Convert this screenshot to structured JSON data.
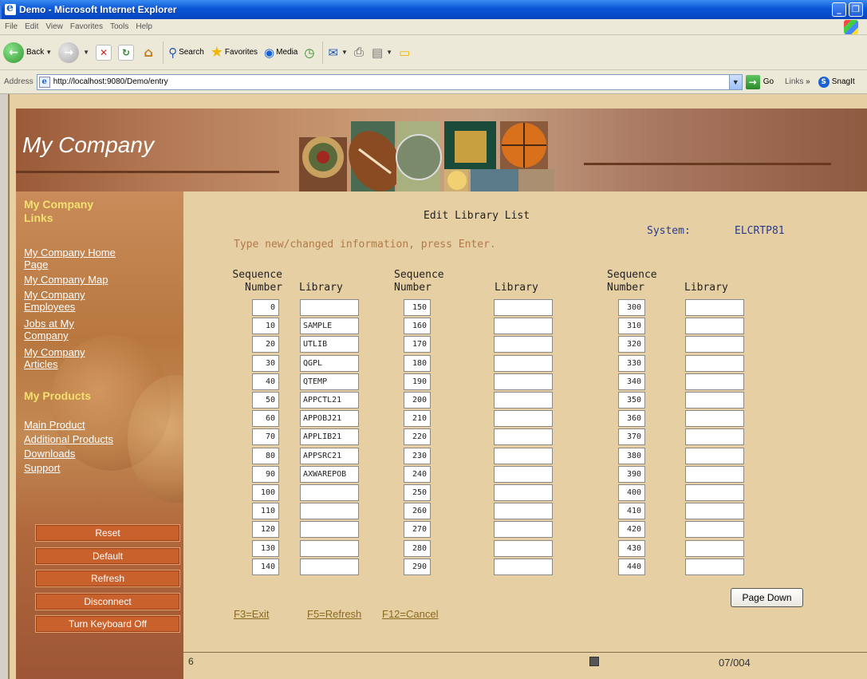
{
  "window": {
    "title": "Demo - Microsoft Internet Explorer",
    "minimize_glyph": "_",
    "maximize_glyph": "❐"
  },
  "menu": [
    "File",
    "Edit",
    "View",
    "Favorites",
    "Tools",
    "Help"
  ],
  "toolbar": {
    "back_label": "Back",
    "search_label": "Search",
    "favorites_label": "Favorites",
    "media_label": "Media"
  },
  "address": {
    "label": "Address",
    "url": "http://localhost:9080/Demo/entry",
    "go_label": "Go",
    "links_label": "Links",
    "chevron": "»",
    "snagit_label": "SnagIt"
  },
  "banner": {
    "brand": "My Company"
  },
  "sidebar": {
    "heading_links": [
      "My Company",
      "Links"
    ],
    "links": [
      [
        "My Company Home",
        "Page"
      ],
      [
        "My Company Map"
      ],
      [
        "My Company",
        "Employees"
      ],
      [
        "Jobs at My",
        "Company"
      ],
      [
        "My Company",
        "Articles"
      ]
    ],
    "heading_products": "My Products",
    "product_links": [
      "Main Product",
      "Additional Products",
      "Downloads",
      "Support"
    ],
    "buttons": [
      "Reset",
      "Default",
      "Refresh",
      "Disconnect",
      "Turn Keyboard Off"
    ]
  },
  "screen": {
    "title": "Edit Library List",
    "system_label": "System:",
    "system_value": "ELCRTP81",
    "instruction": "Type new/changed information, press Enter.",
    "seq_header_1": "Sequence",
    "seq_header_2": "Number",
    "lib_header": "Library"
  },
  "columns": [
    {
      "seq": [
        "0",
        "10",
        "20",
        "30",
        "40",
        "50",
        "60",
        "70",
        "80",
        "90",
        "100",
        "110",
        "120",
        "130",
        "140"
      ],
      "lib": [
        "",
        "SAMPLE",
        "UTLIB",
        "QGPL",
        "QTEMP",
        "APPCTL21",
        "APPOBJ21",
        "APPLIB21",
        "APPSRC21",
        "AXWAREPOB",
        "",
        "",
        "",
        "",
        ""
      ]
    },
    {
      "seq": [
        "150",
        "160",
        "170",
        "180",
        "190",
        "200",
        "210",
        "220",
        "230",
        "240",
        "250",
        "260",
        "270",
        "280",
        "290"
      ],
      "lib": [
        "",
        "",
        "",
        "",
        "",
        "",
        "",
        "",
        "",
        "",
        "",
        "",
        "",
        "",
        ""
      ]
    },
    {
      "seq": [
        "300",
        "310",
        "320",
        "330",
        "340",
        "350",
        "360",
        "370",
        "380",
        "390",
        "400",
        "410",
        "420",
        "430",
        "440"
      ],
      "lib": [
        "",
        "",
        "",
        "",
        "",
        "",
        "",
        "",
        "",
        "",
        "",
        "",
        "",
        "",
        ""
      ]
    }
  ],
  "function_keys": [
    "F3=Exit",
    "F5=Refresh",
    "F12=Cancel"
  ],
  "page_down_label": "Page Down",
  "status": {
    "left": "6",
    "right": "07/004"
  },
  "colors": {
    "banner": "#b47a56",
    "sidebar_button": "#c8612c",
    "page_bg": "#e6cfa2",
    "link_heading": "#f3e070"
  }
}
